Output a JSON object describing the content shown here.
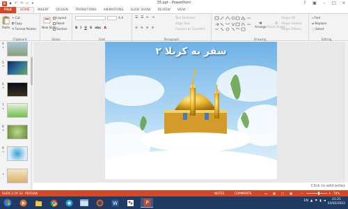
{
  "titlebar": {
    "title": "35.ppt - PowerPoint",
    "app_logo": "P"
  },
  "tabs": [
    "FILE",
    "HOME",
    "INSERT",
    "DESIGN",
    "TRANSITIONS",
    "ANIMATIONS",
    "SLIDE SHOW",
    "REVIEW",
    "VIEW"
  ],
  "ribbon": {
    "clipboard": {
      "paste": "Paste",
      "cut": "Cut",
      "copy": "Copy",
      "format_painter": "Format Painter",
      "label": "Clipboard"
    },
    "slides": {
      "new_slide": "New Slide",
      "layout": "Layout",
      "reset": "Reset",
      "section": "Section",
      "label": "Slides"
    },
    "font": {
      "label": "Font"
    },
    "paragraph": {
      "text_direction": "Text Direction",
      "align_text": "Align Text",
      "convert_smartart": "Convert to SmartArt",
      "label": "Paragraph"
    },
    "drawing": {
      "arrange": "Arrange",
      "quick_styles": "Quick Styles",
      "shape_fill": "Shape Fill",
      "shape_outline": "Shape Outline",
      "shape_effects": "Shape Effects",
      "label": "Drawing"
    },
    "editing": {
      "find": "Find",
      "replace": "Replace",
      "select": "Select",
      "label": "Editing"
    }
  },
  "thumbnails": [
    {
      "num": "4"
    },
    {
      "num": "5"
    },
    {
      "num": "6"
    },
    {
      "num": "7"
    },
    {
      "num": "8"
    },
    {
      "num": "9"
    }
  ],
  "slide": {
    "title": "سفر به کربلا ۲"
  },
  "notes": {
    "placeholder": "Click to add notes"
  },
  "status": {
    "slide_count": "SLIDE 2 OF 23",
    "language": "PERSIAN",
    "notes": "NOTES",
    "comments": "COMMENTS",
    "zoom": "78%"
  },
  "clock": {
    "time": "21:21",
    "date": "03/02/2022"
  },
  "tray": {
    "lang": "EN"
  },
  "colors": {
    "accent": "#d24726",
    "taskbar": "#1f3b63",
    "ribbon": "#f3f3f3"
  }
}
